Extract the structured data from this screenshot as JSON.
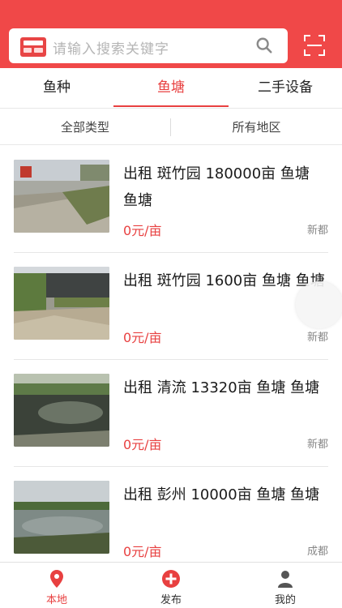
{
  "search": {
    "placeholder": "请输入搜索关键字"
  },
  "tabs": [
    {
      "label": "鱼种"
    },
    {
      "label": "鱼塘"
    },
    {
      "label": "二手设备"
    }
  ],
  "filters": {
    "type_label": "全部类型",
    "region_label": "所有地区"
  },
  "listings": [
    {
      "title": "出租 斑竹园 180000亩 鱼塘 鱼塘",
      "price": "0元/亩",
      "location": "新都"
    },
    {
      "title": "出租 斑竹园 1600亩 鱼塘 鱼塘",
      "price": "0元/亩",
      "location": "新都"
    },
    {
      "title": "出租 清流 13320亩 鱼塘 鱼塘",
      "price": "0元/亩",
      "location": "新都"
    },
    {
      "title": "出租 彭州 10000亩 鱼塘 鱼塘",
      "price": "0元/亩",
      "location": "成都"
    }
  ],
  "bottom_nav": [
    {
      "label": "本地",
      "icon": "location-pin-icon"
    },
    {
      "label": "发布",
      "icon": "plus-circle-icon"
    },
    {
      "label": "我的",
      "icon": "user-icon"
    }
  ],
  "colors": {
    "accent": "#e84040",
    "header_bg": "#f04848"
  }
}
